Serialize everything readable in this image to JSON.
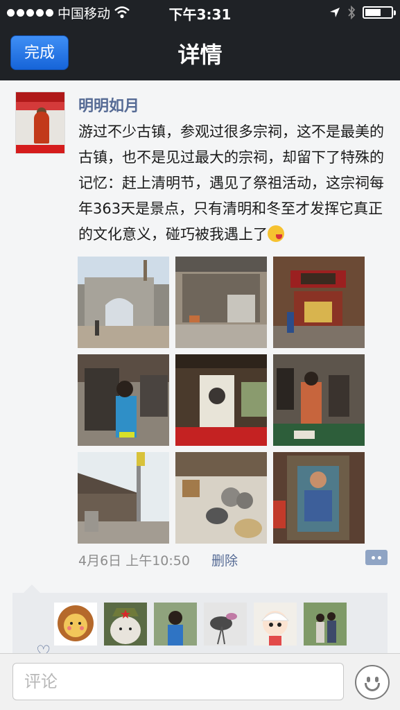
{
  "status_bar": {
    "carrier": "中国移动",
    "time": "下午3:31",
    "battery_level": 0.6
  },
  "nav": {
    "done_label": "完成",
    "title": "详情"
  },
  "post": {
    "username": "明明如月",
    "text": "游过不少古镇，参观过很多宗祠，这不是最美的古镇，也不是见过最大的宗祠，却留下了特殊的记忆：赶上清明节，遇见了祭祖活动，这宗祠每年363天是景点，只有清明和冬至才发挥它真正的文化意义，碰巧被我遇上了",
    "emoji": "winking-tongue-out-emoji",
    "timestamp": "4月6日 上午10:50",
    "delete_label": "删除",
    "photos": [
      {
        "name": "stone-gate-photo"
      },
      {
        "name": "ancestral-hall-courtyard-photo"
      },
      {
        "name": "ancestral-hall-altar-photo"
      },
      {
        "name": "child-in-costume-photo"
      },
      {
        "name": "ancestor-portrait-photo"
      },
      {
        "name": "musicians-photo"
      },
      {
        "name": "old-street-photo"
      },
      {
        "name": "offering-bowls-photo"
      },
      {
        "name": "door-god-painting-photo"
      }
    ],
    "likers": [
      {
        "name": "lion-cartoon-avatar"
      },
      {
        "name": "plush-toy-avatar"
      },
      {
        "name": "girl-portrait-avatar"
      },
      {
        "name": "ink-painting-avatar"
      },
      {
        "name": "doll-avatar"
      },
      {
        "name": "couple-photo-avatar"
      }
    ]
  },
  "comment_bar": {
    "placeholder": "评论"
  },
  "colors": {
    "header_bg": "#1f2226",
    "done_button": "#2178e8",
    "link_blue": "#566b95",
    "content_bg": "#f4f5f6"
  }
}
